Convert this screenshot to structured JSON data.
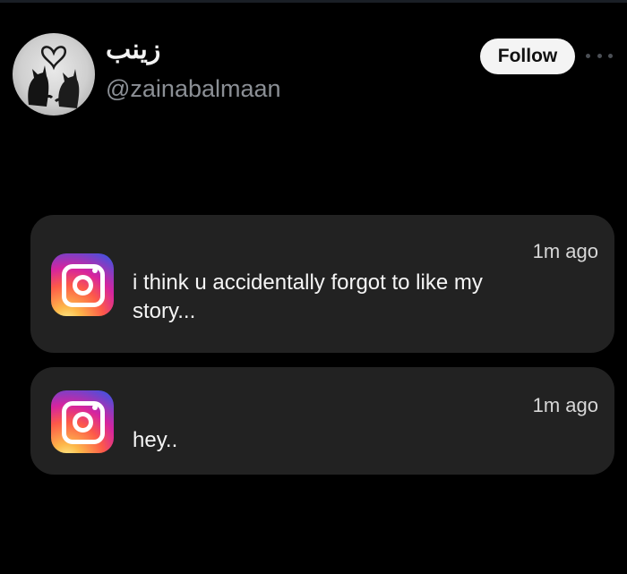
{
  "profile": {
    "display_name": "زينب",
    "handle": "@zainabalmaan",
    "follow_label": "Follow",
    "avatar_icon": "two-cats-heart-avatar",
    "more_icon": "more-dots-icon"
  },
  "notifications": [
    {
      "app_icon": "instagram-icon",
      "timestamp": "1m ago",
      "message": "i think u accidentally forgot to like my story..."
    },
    {
      "app_icon": "instagram-icon",
      "timestamp": "1m ago",
      "message": "hey.."
    }
  ],
  "colors": {
    "background": "#000000",
    "card": "#222222",
    "handle": "#8b8f95",
    "follow_button": "#f4f4f4"
  }
}
